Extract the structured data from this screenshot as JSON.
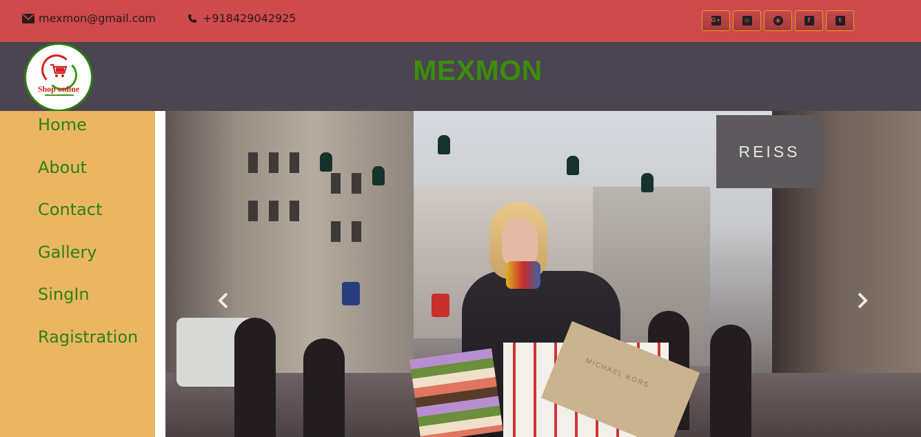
{
  "topbar": {
    "email": "mexmon@gmail.com",
    "phone": "+918429042925",
    "social": [
      {
        "name": "google-plus-icon",
        "glyph": "G+"
      },
      {
        "name": "instagram-icon",
        "glyph": "◎"
      },
      {
        "name": "chrome-icon",
        "glyph": "◉"
      },
      {
        "name": "facebook-icon",
        "glyph": "f"
      },
      {
        "name": "twitter-icon",
        "glyph": "t"
      }
    ]
  },
  "header": {
    "brand": "MEXMON",
    "logo_text": "Shop online"
  },
  "sidebar": {
    "items": [
      {
        "label": "Home"
      },
      {
        "label": "About"
      },
      {
        "label": "Contact"
      },
      {
        "label": "Gallery"
      },
      {
        "label": "SingIn"
      },
      {
        "label": "Ragistration"
      }
    ]
  },
  "carousel": {
    "store_sign": "REISS",
    "bag_text": "MICHAEL KORS",
    "prev_icon": "chevron-left-icon",
    "next_icon": "chevron-right-icon"
  },
  "colors": {
    "topbar": "#cf4a4c",
    "header": "#4a4550",
    "brand": "#3c8d0d",
    "sidebar": "#ebb662",
    "nav_link": "#2d8012"
  }
}
